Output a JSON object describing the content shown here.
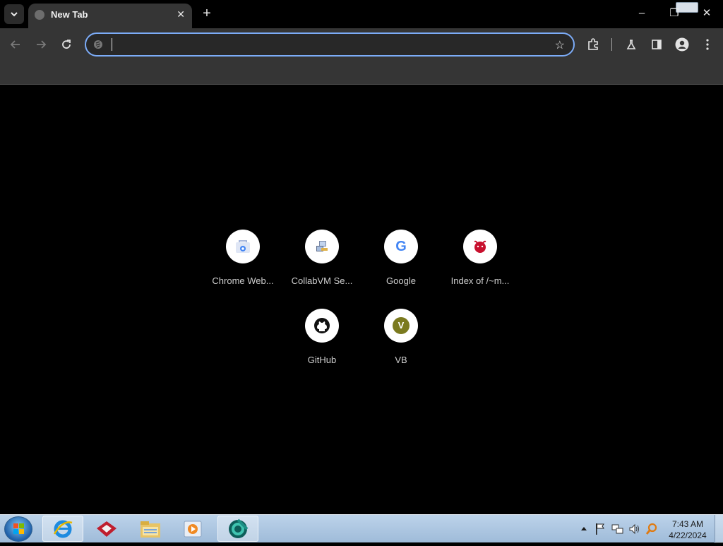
{
  "browser": {
    "tab_title": "New Tab",
    "omnibox_value": "",
    "omnibox_placeholder": ""
  },
  "icons": {
    "tab_search": "chevron-down-icon",
    "back": "arrow-left-icon",
    "forward": "arrow-right-icon",
    "reload": "reload-icon",
    "bookmark": "star-icon",
    "extensions": "puzzle-icon",
    "labs": "flask-icon",
    "side_panel": "side-panel-icon",
    "profile": "profile-icon",
    "menu": "three-dots-icon"
  },
  "shortcuts": [
    {
      "label": "Chrome Web...",
      "icon": "chrome-web-store-icon"
    },
    {
      "label": "CollabVM Se...",
      "icon": "collabvm-icon"
    },
    {
      "label": "Google",
      "icon": "google-icon",
      "letter": "G"
    },
    {
      "label": "Index of /~m...",
      "icon": "freebsd-icon"
    },
    {
      "label": "GitHub",
      "icon": "github-icon"
    },
    {
      "label": "VB",
      "icon": "letter-v-icon",
      "letter": "V"
    }
  ],
  "taskbar": {
    "apps": [
      "internet-explorer-icon",
      "filezilla-icon",
      "file-explorer-icon",
      "media-player-icon",
      "chrome-beta-icon"
    ],
    "time": "7:43 AM",
    "date": "4/22/2024"
  },
  "colors": {
    "accent": "#7cacf8",
    "toolbar": "#353535",
    "background": "#000000"
  }
}
